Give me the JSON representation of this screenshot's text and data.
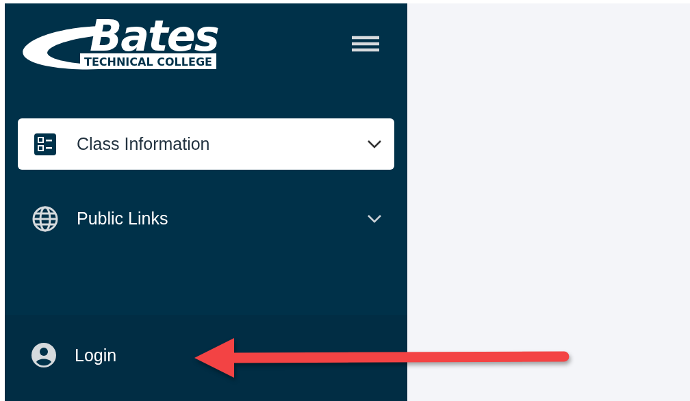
{
  "logo": {
    "title": "Bates",
    "subtitle": "TECHNICAL COLLEGE"
  },
  "sidebar": {
    "items": [
      {
        "label": "Class Information",
        "kind": "list",
        "selected": true,
        "expanded": false
      },
      {
        "label": "Public Links",
        "kind": "globe",
        "selected": false,
        "expanded": false
      }
    ],
    "footer": {
      "label": "Login",
      "kind": "user"
    }
  },
  "annotation": {
    "kind": "arrow"
  }
}
